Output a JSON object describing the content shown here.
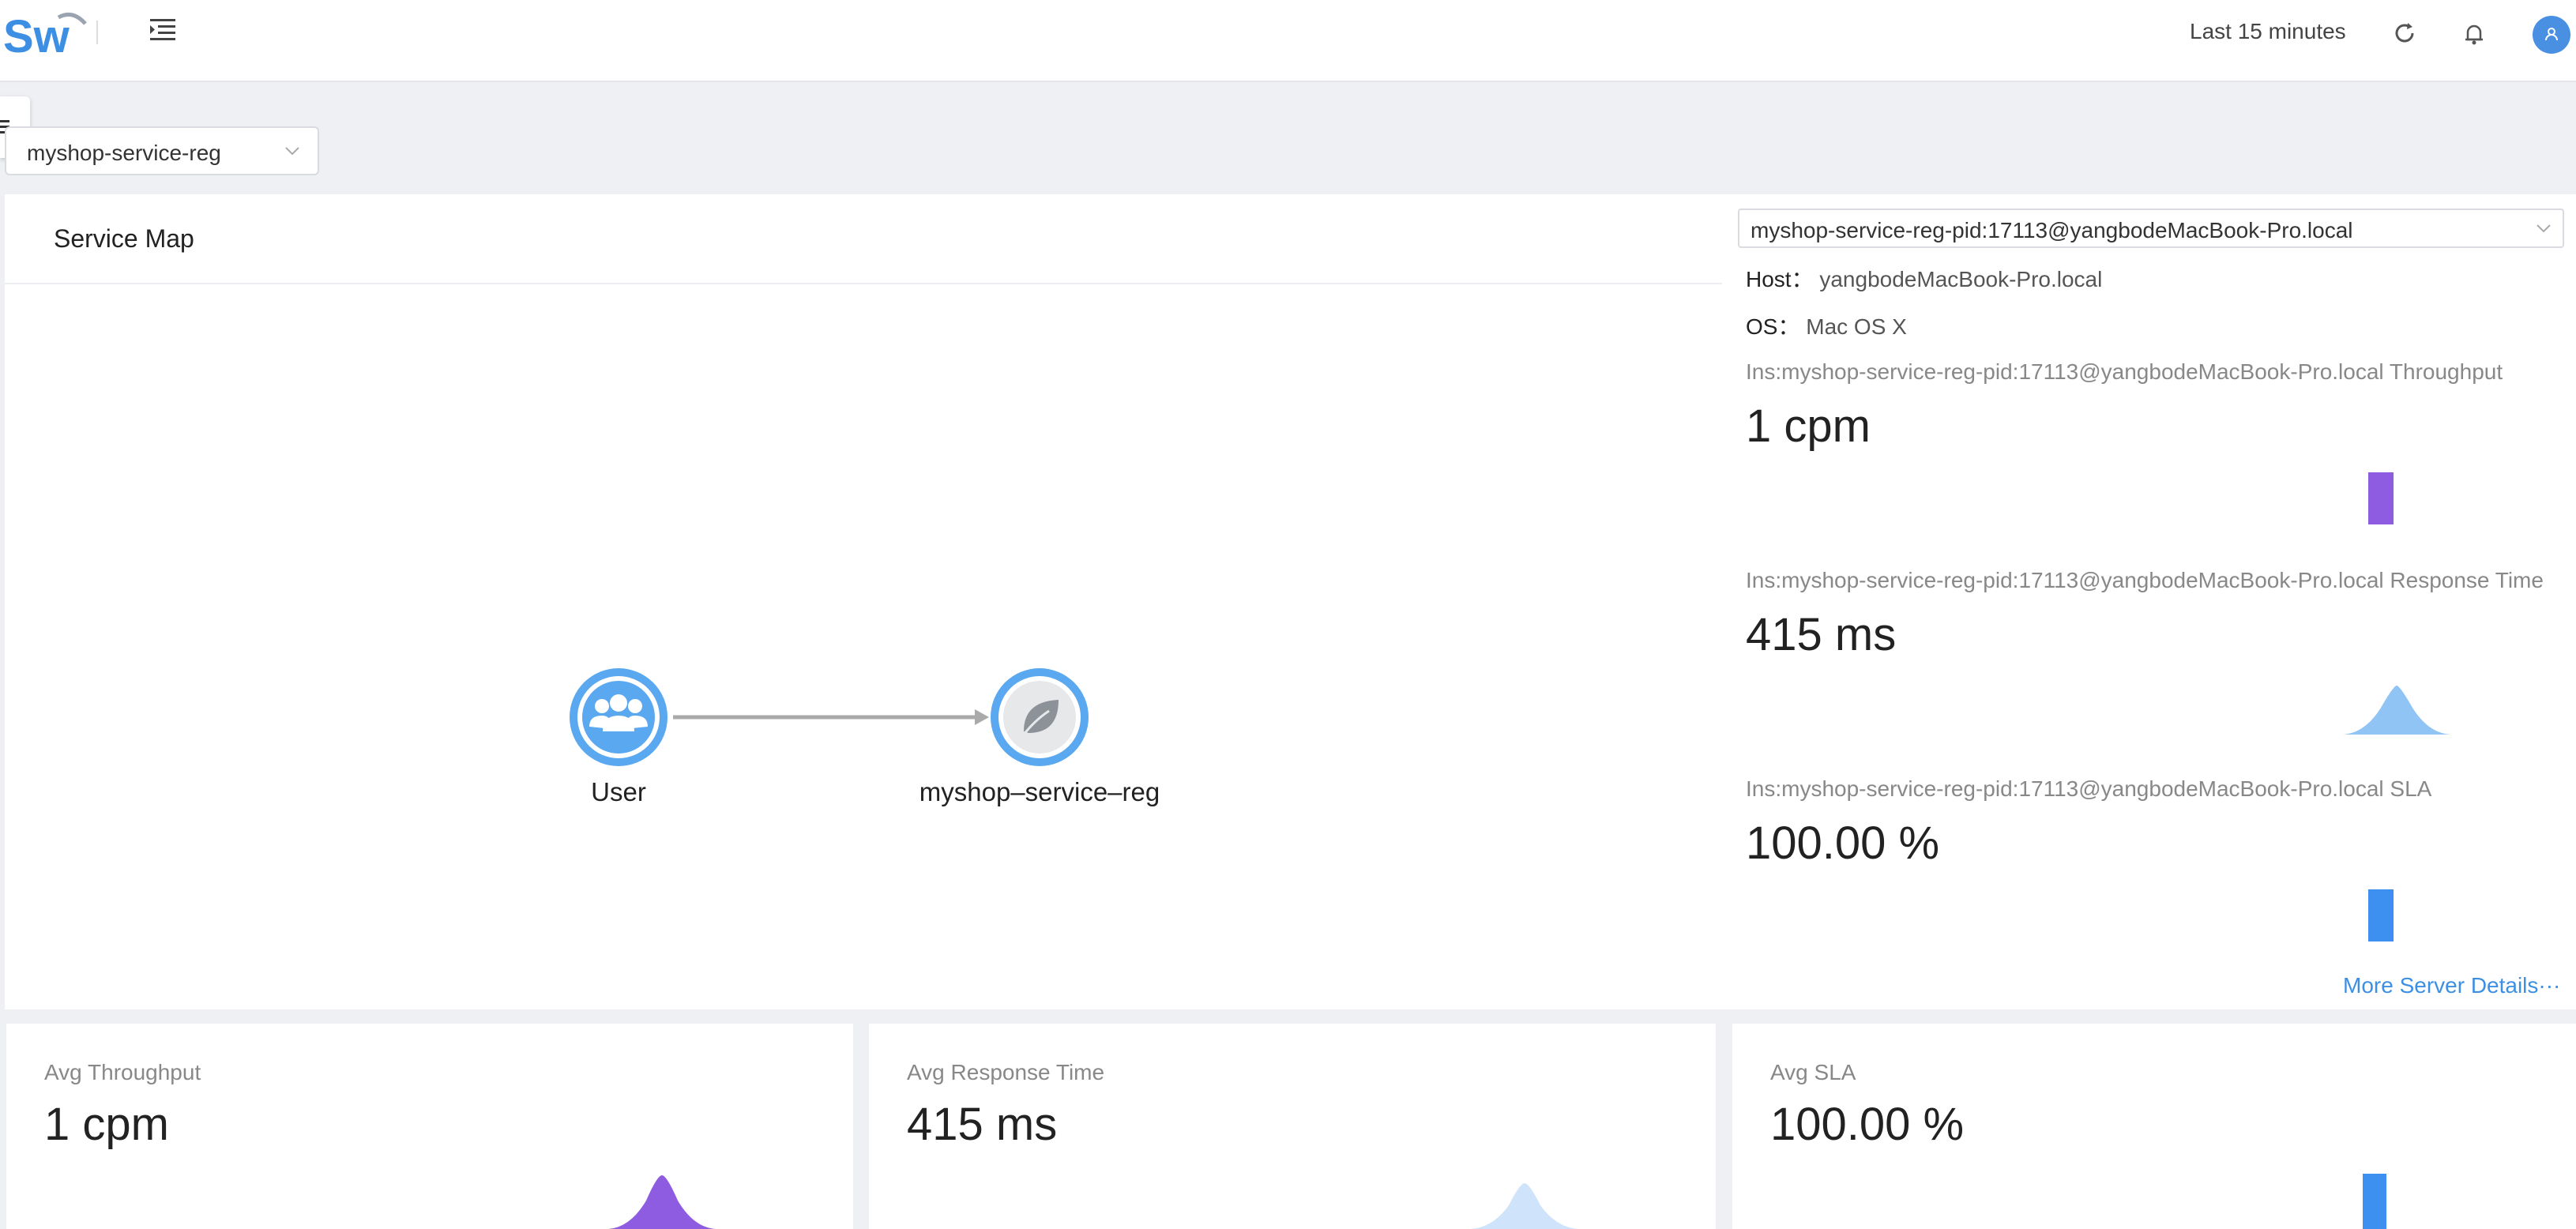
{
  "header": {
    "logo_text": "Sw",
    "time_range": "Last 15 minutes",
    "icons": [
      "menu-toggle-icon",
      "refresh-icon",
      "bell-icon",
      "user-avatar-icon"
    ]
  },
  "service_select": {
    "value": "myshop-service-reg"
  },
  "service_map": {
    "title": "Service Map",
    "nodes": [
      {
        "id": "user",
        "label": "User",
        "icon": "users-icon"
      },
      {
        "id": "svc",
        "label": "myshop–service–reg",
        "icon": "spring-leaf-icon"
      }
    ],
    "edges": [
      {
        "from": "user",
        "to": "svc"
      }
    ]
  },
  "instance": {
    "select_value": "myshop-service-reg-pid:17113@yangbodeMacBook-Pro.local",
    "host_label": "Host：",
    "host_value": "yangbodeMacBook-Pro.local",
    "os_label": "OS：",
    "os_value": "Mac OS X",
    "metrics": [
      {
        "label": "Ins:myshop-service-reg-pid:17113@yangbodeMacBook-Pro.local Throughput",
        "value": "1 cpm",
        "color": "#8e5ce0"
      },
      {
        "label": "Ins:myshop-service-reg-pid:17113@yangbodeMacBook-Pro.local Response Time",
        "value": "415 ms",
        "color": "#8fc4f5"
      },
      {
        "label": "Ins:myshop-service-reg-pid:17113@yangbodeMacBook-Pro.local SLA",
        "value": "100.00 %",
        "color": "#3d8ff0"
      }
    ],
    "more_link": "More Server Details···"
  },
  "cards": [
    {
      "label": "Avg Throughput",
      "value": "1 cpm",
      "color": "#8e5ce0"
    },
    {
      "label": "Avg Response Time",
      "value": "415 ms",
      "color": "#cfe3fa"
    },
    {
      "label": "Avg SLA",
      "value": "100.00 %",
      "color": "#3d8ff0"
    }
  ],
  "colors": {
    "accent": "#3d8fe4",
    "node_ring": "#5aa8f0"
  }
}
